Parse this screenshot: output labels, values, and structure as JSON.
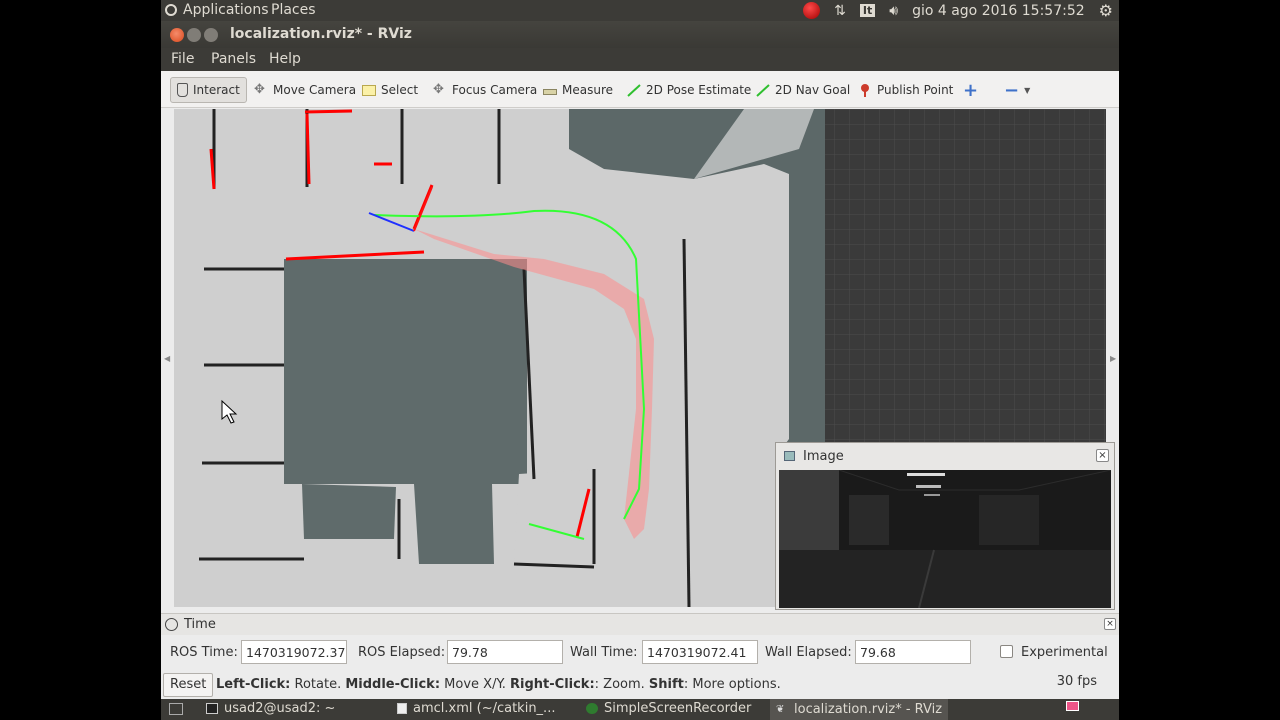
{
  "system_panel": {
    "applications": "Applications",
    "places": "Places",
    "keyboard_layout": "It",
    "datetime": "gio  4 ago 2016 15:57:52"
  },
  "window": {
    "title": "localization.rviz* - RViz"
  },
  "menu": [
    "File",
    "Panels",
    "Help"
  ],
  "toolbar": {
    "tools": [
      "Interact",
      "Move Camera",
      "Select",
      "Focus Camera",
      "Measure",
      "2D Pose Estimate",
      "2D Nav Goal",
      "Publish Point"
    ],
    "active_tool": "Interact"
  },
  "image_panel": {
    "title": "Image"
  },
  "time_panel": {
    "title": "Time",
    "ros_time_label": "ROS Time:",
    "ros_time": "1470319072.37",
    "ros_elapsed_label": "ROS Elapsed:",
    "ros_elapsed": "79.78",
    "wall_time_label": "Wall Time:",
    "wall_time": "1470319072.41",
    "wall_elapsed_label": "Wall Elapsed:",
    "wall_elapsed": "79.68",
    "experimental_label": "Experimental",
    "experimental_checked": false
  },
  "status_bar": {
    "reset": "Reset",
    "left_click_key": "Left-Click:",
    "left_click_text": " Rotate. ",
    "middle_click_key": "Middle-Click:",
    "middle_click_text": " Move X/Y. ",
    "right_click_key": "Right-Click:",
    "right_click_text": ": Zoom. ",
    "shift_key": "Shift",
    "shift_text": ": More options.",
    "fps": "30 fps"
  },
  "taskbar": {
    "items": [
      "usad2@usad2: ~",
      "amcl.xml (~/catkin_...",
      "SimpleScreenRecorder",
      "localization.rviz* - RViz"
    ],
    "active": "localization.rviz* - RViz"
  },
  "colors": {
    "map_free": "#cdcdcd",
    "map_unknown": "#5c6868",
    "laser_scan": "#ff0000",
    "path": "#00ff00",
    "particles": "#ff6e6e",
    "grid": "#555555"
  }
}
